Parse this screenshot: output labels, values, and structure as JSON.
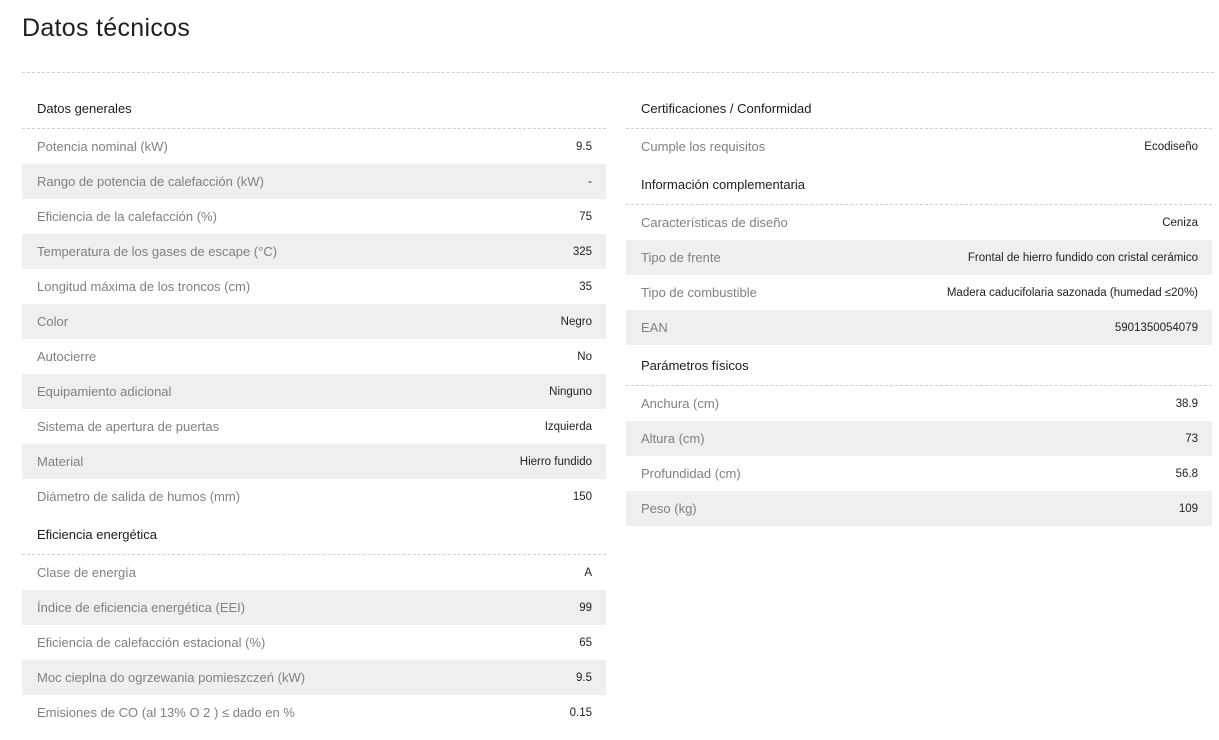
{
  "title": "Datos técnicos",
  "left_sections": [
    {
      "title": "Datos generales",
      "rows": [
        {
          "label": "Potencia nominal (kW)",
          "value": "9.5"
        },
        {
          "label": "Rango de potencia de calefacción (kW)",
          "value": "-"
        },
        {
          "label": "Eficiencia de la calefacción (%)",
          "value": "75"
        },
        {
          "label": "Temperatura de los gases de escape (°C)",
          "value": "325"
        },
        {
          "label": "Longitud máxima de los troncos (cm)",
          "value": "35"
        },
        {
          "label": "Color",
          "value": "Negro"
        },
        {
          "label": "Autocierre",
          "value": "No"
        },
        {
          "label": "Equipamiento adicional",
          "value": "Ninguno"
        },
        {
          "label": "Sistema de apertura de puertas",
          "value": "Izquierda"
        },
        {
          "label": "Material",
          "value": "Hierro fundido"
        },
        {
          "label": "Diámetro de salida de humos (mm)",
          "value": "150"
        }
      ]
    },
    {
      "title": "Eficiencia energética",
      "rows": [
        {
          "label": "Clase de energía",
          "value": "A"
        },
        {
          "label": "Índice de eficiencia energética (EEI)",
          "value": "99"
        },
        {
          "label": "Eficiencia de calefacción estacional (%)",
          "value": "65"
        },
        {
          "label": "Moc cieplna do ogrzewania pomieszczeń (kW)",
          "value": "9.5"
        },
        {
          "label": "Emisiones de CO (al 13% O 2 ) ≤ dado en %",
          "value": "0.15"
        }
      ]
    }
  ],
  "right_sections": [
    {
      "title": "Certificaciones / Conformidad",
      "rows": [
        {
          "label": "Cumple los requisitos",
          "value": "Ecodiseño"
        }
      ]
    },
    {
      "title": "Información complementaria",
      "rows": [
        {
          "label": "Características de diseño",
          "value": "Ceniza"
        },
        {
          "label": "Tipo de frente",
          "value": "Frontal de hierro fundido con cristal cerámico"
        },
        {
          "label": "Tipo de combustible",
          "value": "Madera caducifolaria sazonada (humedad ≤20%)"
        },
        {
          "label": "EAN",
          "value": "5901350054079"
        }
      ]
    },
    {
      "title": "Parámetros físicos",
      "rows": [
        {
          "label": "Anchura (cm)",
          "value": "38.9"
        },
        {
          "label": "Altura (cm)",
          "value": "73"
        },
        {
          "label": "Profundidad (cm)",
          "value": "56.8"
        },
        {
          "label": "Peso (kg)",
          "value": "109"
        }
      ]
    }
  ]
}
